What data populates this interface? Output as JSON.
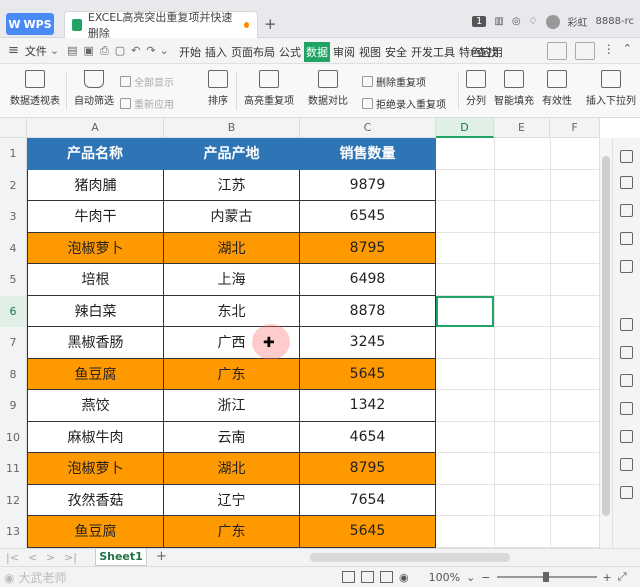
{
  "titlebar": {
    "app_label": "WPS",
    "doc_tab": "EXCEL高亮突出重复项并快速删除",
    "add_tab": "+",
    "badge": "1",
    "user_name": "彩虹",
    "account": "8888-rc"
  },
  "menubar": {
    "file_label": "文件",
    "tabs": [
      "开始",
      "插入",
      "页面布局",
      "公式",
      "数据",
      "审阅",
      "视图",
      "安全",
      "开发工具",
      "特色应用"
    ],
    "active_tab": "数据",
    "search_label": "查找"
  },
  "ribbon": {
    "pivot_table": "数据透视表",
    "auto_filter": "自动筛选",
    "show_all": "全部显示",
    "reapply": "重新应用",
    "sort": "排序",
    "highlight_duplicates": "高亮重复项",
    "data_compare": "数据对比",
    "delete_duplicates": "删除重复项",
    "reject_duplicates": "拒绝录入重复项",
    "split_column": "分列",
    "smart_fill": "智能填充",
    "validity": "有效性",
    "insert_dropdown": "插入下拉列"
  },
  "columns": [
    "A",
    "B",
    "C",
    "D",
    "E",
    "F"
  ],
  "rows": [
    "1",
    "2",
    "3",
    "4",
    "5",
    "6",
    "7",
    "8",
    "9",
    "10",
    "11",
    "12",
    "13"
  ],
  "table": {
    "headers": [
      "产品名称",
      "产品产地",
      "销售数量"
    ],
    "rows": [
      {
        "name": "猪肉脯",
        "origin": "江苏",
        "qty": "9879",
        "highlight": false
      },
      {
        "name": "牛肉干",
        "origin": "内蒙古",
        "qty": "6545",
        "highlight": false
      },
      {
        "name": "泡椒萝卜",
        "origin": "湖北",
        "qty": "8795",
        "highlight": true
      },
      {
        "name": "培根",
        "origin": "上海",
        "qty": "6498",
        "highlight": false
      },
      {
        "name": "辣白菜",
        "origin": "东北",
        "qty": "8878",
        "highlight": false
      },
      {
        "name": "黑椒香肠",
        "origin": "广西",
        "qty": "3245",
        "highlight": false
      },
      {
        "name": "鱼豆腐",
        "origin": "广东",
        "qty": "5645",
        "highlight": true
      },
      {
        "name": "燕饺",
        "origin": "浙江",
        "qty": "1342",
        "highlight": false
      },
      {
        "name": "麻椒牛肉",
        "origin": "云南",
        "qty": "4654",
        "highlight": false
      },
      {
        "name": "泡椒萝卜",
        "origin": "湖北",
        "qty": "8795",
        "highlight": true
      },
      {
        "name": "孜然香菇",
        "origin": "辽宁",
        "qty": "7654",
        "highlight": false
      },
      {
        "name": "鱼豆腐",
        "origin": "广东",
        "qty": "5645",
        "highlight": true
      }
    ]
  },
  "colors": {
    "header_bg": "#2e75b6",
    "highlight_bg": "#ff9900",
    "accent": "#21a366"
  },
  "sheet": {
    "tab": "Sheet1",
    "add": "+"
  },
  "status": {
    "watermark": "大武老师",
    "zoom": "100%"
  }
}
